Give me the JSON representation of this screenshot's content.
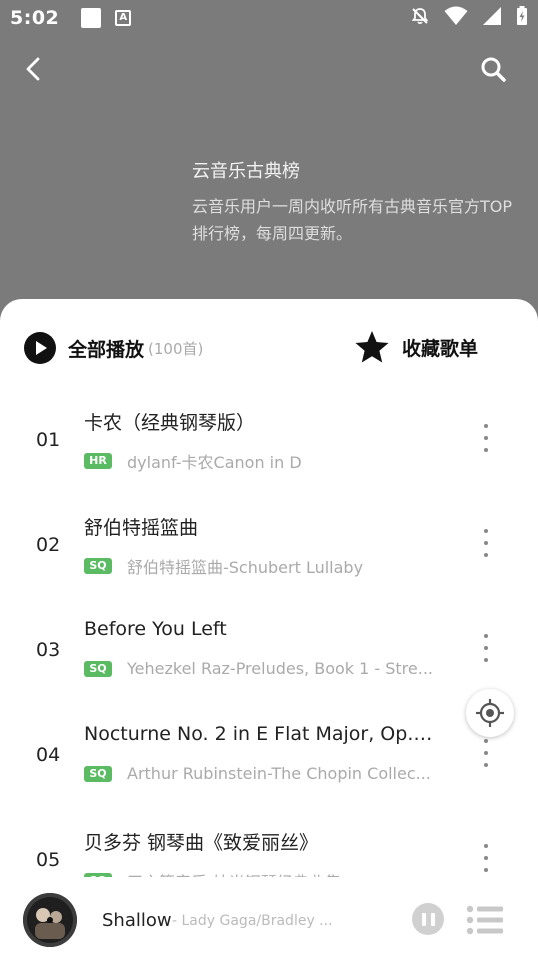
{
  "status_bar": {
    "time": "5:02"
  },
  "header": {
    "title": "云音乐古典榜",
    "description": "云音乐用户一周内收听所有古典音乐官方TOP排行榜，每周四更新。"
  },
  "actions": {
    "play_all_label": "全部播放",
    "play_all_count": "(100首)",
    "collect_label": "收藏歌单"
  },
  "songs": [
    {
      "index": "01",
      "title": "卡农（经典钢琴版）",
      "quality": "HR",
      "artist": "dylanf-卡农Canon in D"
    },
    {
      "index": "02",
      "title": "舒伯特摇篮曲",
      "quality": "SQ",
      "artist": "舒伯特摇篮曲-Schubert Lullaby"
    },
    {
      "index": "03",
      "title": "Before You Left",
      "quality": "SQ",
      "artist": "Yehezkel Raz-Preludes, Book 1 - Stre..."
    },
    {
      "index": "04",
      "title": "Nocturne No. 2 in E Flat Major, Op. 9...",
      "quality": "SQ",
      "artist": "Arthur Rubinstein-The Chopin Collec..."
    },
    {
      "index": "05",
      "title": "贝多芬 钢琴曲《致爱丽丝》",
      "quality": "SQ",
      "artist": "天之籁音乐-烛光钢琴经典曲集"
    }
  ],
  "now_playing": {
    "title": "Shallow",
    "artist": "- Lady Gaga/Bradley ..."
  },
  "icons": {
    "back": "back-arrow-icon",
    "search": "search-icon",
    "play": "play-circle-icon",
    "star": "star-icon",
    "more": "more-vertical-icon",
    "locate": "locate-icon",
    "pause": "pause-icon",
    "playlist": "playlist-icon"
  },
  "colors": {
    "header_bg": "#7b7b7b",
    "quality_badge": "#5bbb63",
    "text_primary": "#222222",
    "text_secondary": "#aaaaaa"
  }
}
